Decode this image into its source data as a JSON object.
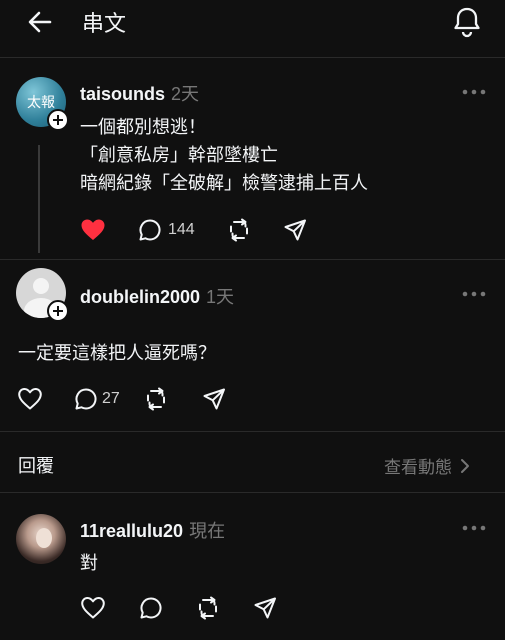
{
  "header": {
    "title": "串文",
    "back_icon": "arrow-left-icon",
    "notify_icon": "bell-icon"
  },
  "post": {
    "username": "taisounds",
    "time": "2天",
    "avatar_text": "太報",
    "lines": [
      "一個都別想逃！",
      "「創意私房」幹部墜樓亡",
      "暗網紀錄「全破解」檢警逮捕上百人"
    ],
    "liked": true,
    "like_color": "#ff3040",
    "comment_count": "144"
  },
  "reply1": {
    "username": "doublelin2000",
    "time": "1天",
    "text": "一定要這樣把人逼死嗎？",
    "comment_count": "27"
  },
  "replies_section": {
    "label": "回覆",
    "activity_label": "查看動態"
  },
  "reply2": {
    "username": "11reallulu20",
    "time": "現在",
    "text": "對"
  }
}
